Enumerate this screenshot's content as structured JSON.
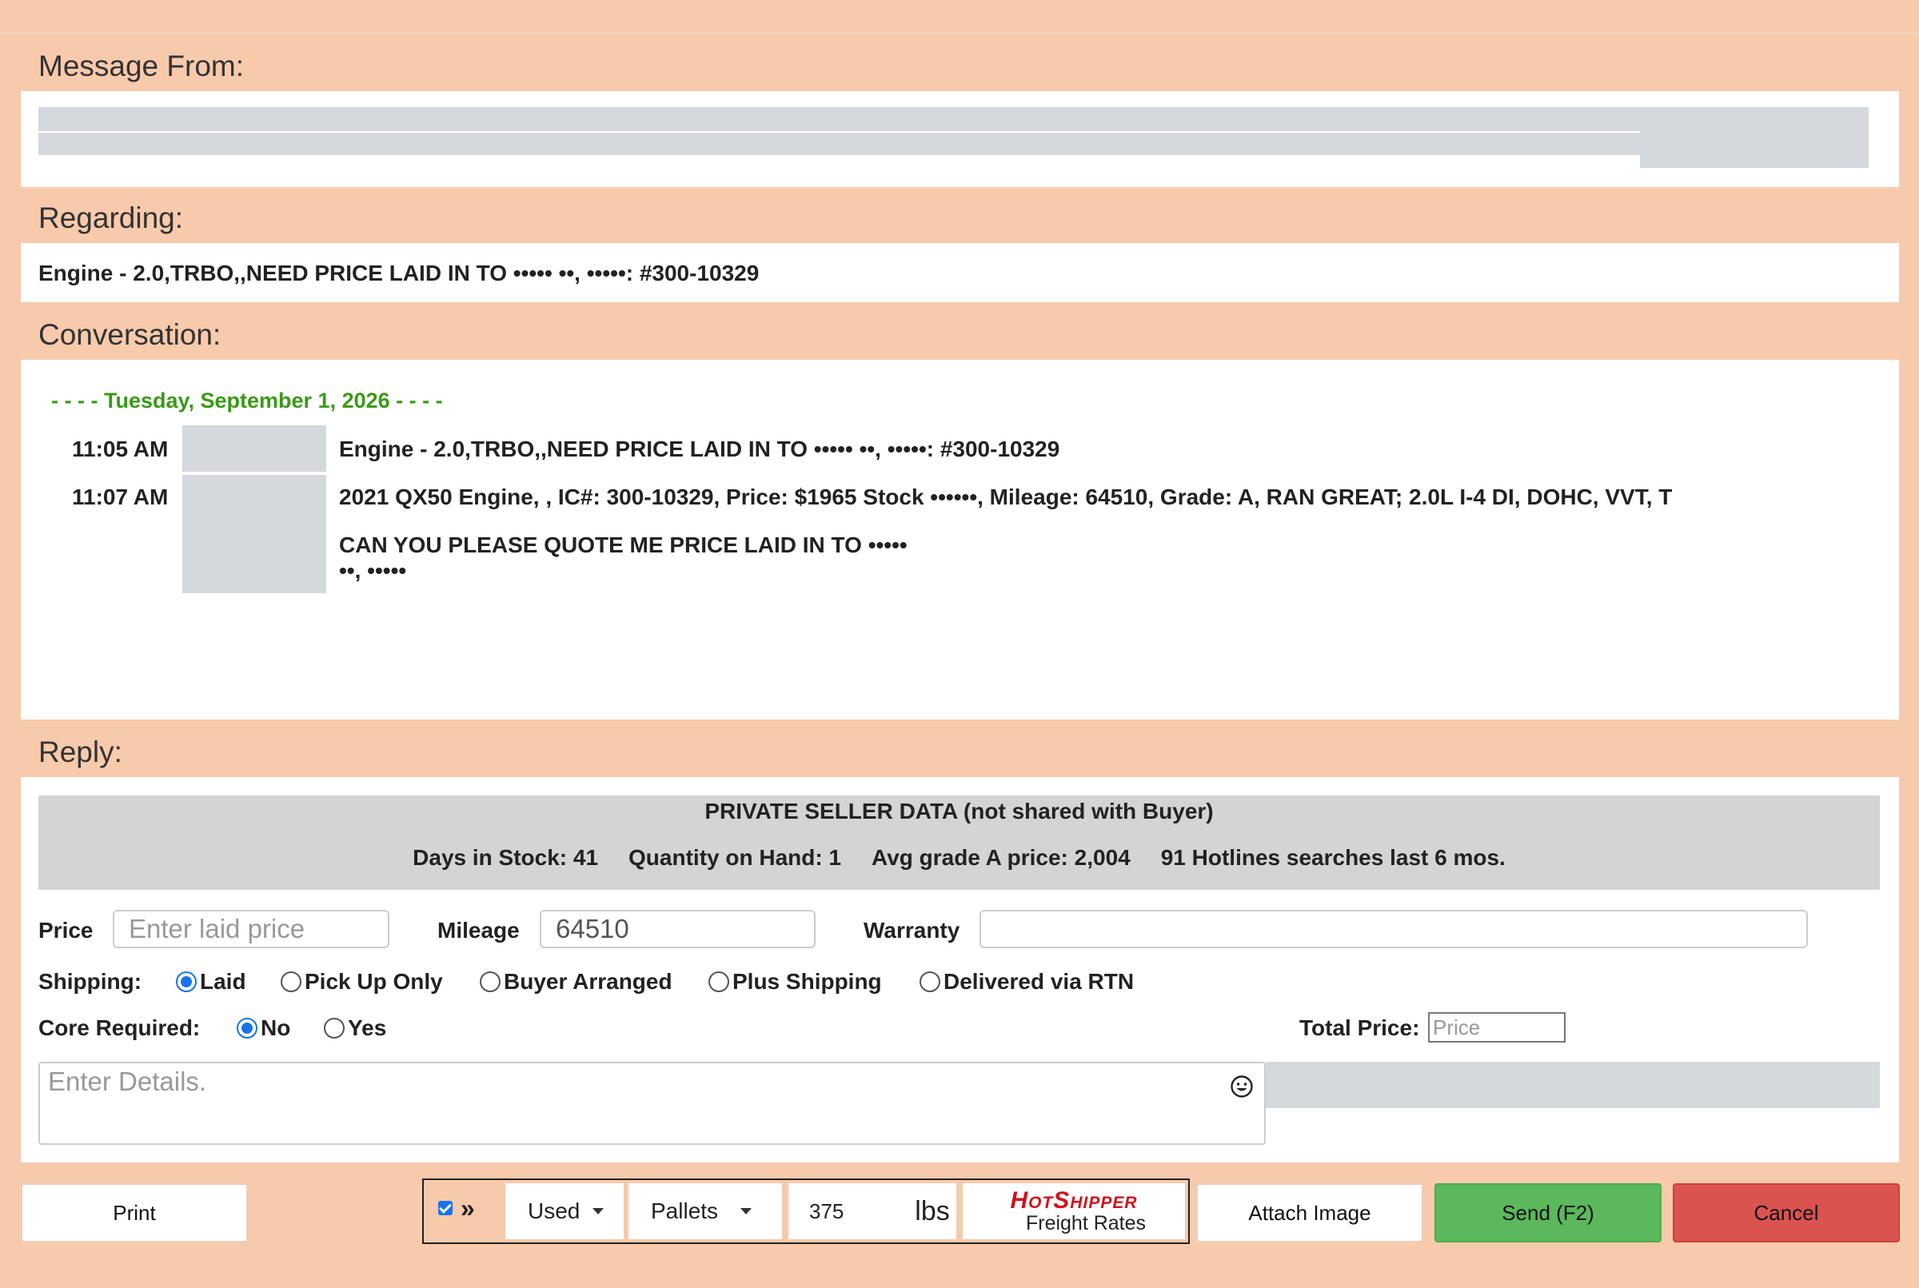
{
  "message_from": {
    "label": "Message From:"
  },
  "regarding": {
    "label": "Regarding:",
    "text": "Engine - 2.0,TRBO,,NEED PRICE LAID IN TO ••••• ••, •••••: #300-10329"
  },
  "conversation": {
    "label": "Conversation:",
    "date": "- - - - Tuesday, September 1, 2026 - - - -",
    "messages": [
      {
        "time": "11:05 AM",
        "lines": [
          "Engine - 2.0,TRBO,,NEED PRICE LAID IN TO ••••• ••, •••••: #300-10329"
        ]
      },
      {
        "time": "11:07 AM",
        "lines": [
          "2021 QX50 Engine, , IC#: 300-10329, Price: $1965 Stock ••••••, Mileage: 64510, Grade: A, RAN GREAT; 2.0L I-4 DI, DOHC, VVT, T",
          "CAN YOU PLEASE QUOTE ME PRICE LAID IN TO •••••",
          "••, •••••"
        ]
      }
    ]
  },
  "reply": {
    "label": "Reply:",
    "private": {
      "title": "PRIVATE SELLER DATA (not shared with Buyer)",
      "stats": [
        "Days in Stock: 41",
        "Quantity on Hand: 1",
        "Avg grade A price: 2,004",
        "91 Hotlines searches last 6 mos."
      ]
    },
    "price_label": "Price",
    "price_placeholder": "Enter laid price",
    "mileage_label": "Mileage",
    "mileage_value": "64510",
    "warranty_label": "Warranty",
    "warranty_value": "",
    "shipping_label": "Shipping:",
    "shipping_options": [
      "Laid",
      "Pick Up Only",
      "Buyer Arranged",
      "Plus Shipping",
      "Delivered via RTN"
    ],
    "shipping_selected": "Laid",
    "core_label": "Core Required:",
    "core_options": [
      "No",
      "Yes"
    ],
    "core_selected": "No",
    "total_label": "Total Price:",
    "total_placeholder": "Price",
    "details_placeholder": "Enter Details."
  },
  "toolbar": {
    "print": "Print",
    "arrows": "»",
    "condition": "Used",
    "unit": "Pallets",
    "weight": "375",
    "weight_unit": "lbs",
    "hotshipper_logo": "HotShipper",
    "hotshipper_sub": "Freight Rates",
    "attach": "Attach Image",
    "send": "Send (F2)",
    "cancel": "Cancel"
  },
  "colors": {
    "background": "#f8caac",
    "date_green": "#3a9a17",
    "send": "#5cb85c",
    "cancel": "#d9534f",
    "hotshipper": "#d0121b"
  }
}
